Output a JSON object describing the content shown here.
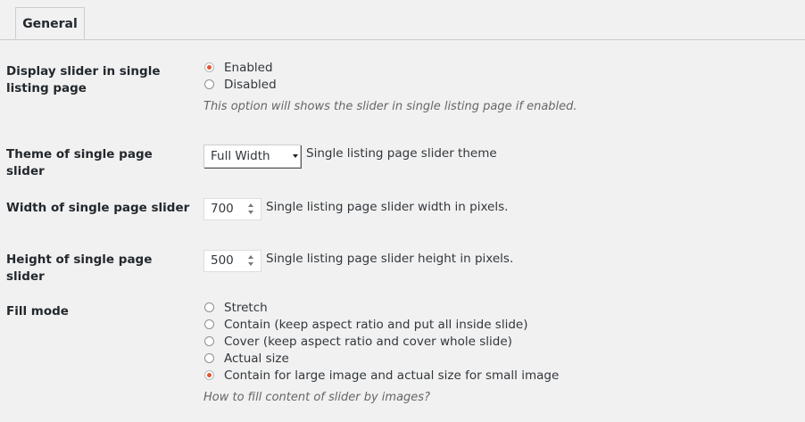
{
  "tabs": [
    {
      "label": "General",
      "active": true
    }
  ],
  "display_slider": {
    "label": "Display slider in single listing page",
    "options": [
      {
        "label": "Enabled",
        "checked": true
      },
      {
        "label": "Disabled",
        "checked": false
      }
    ],
    "description": "This option will shows the slider in single listing page if enabled."
  },
  "theme": {
    "label": "Theme of single page slider",
    "selected": "Full Width",
    "description": "Single listing page slider theme"
  },
  "width": {
    "label": "Width of single page slider",
    "value": "700",
    "description": "Single listing page slider width in pixels."
  },
  "height": {
    "label": "Height of single page slider",
    "value": "500",
    "description": "Single listing page slider height in pixels."
  },
  "fill_mode": {
    "label": "Fill mode",
    "options": [
      {
        "label": "Stretch",
        "checked": false
      },
      {
        "label": "Contain (keep aspect ratio and put all inside slide)",
        "checked": false
      },
      {
        "label": "Cover (keep aspect ratio and cover whole slide)",
        "checked": false
      },
      {
        "label": "Actual size",
        "checked": false
      },
      {
        "label": "Contain for large image and actual size for small image",
        "checked": true
      }
    ],
    "description": "How to fill content of slider by images?"
  },
  "colors": {
    "accent_radio": "#e2562f",
    "background": "#f1f1f1"
  }
}
